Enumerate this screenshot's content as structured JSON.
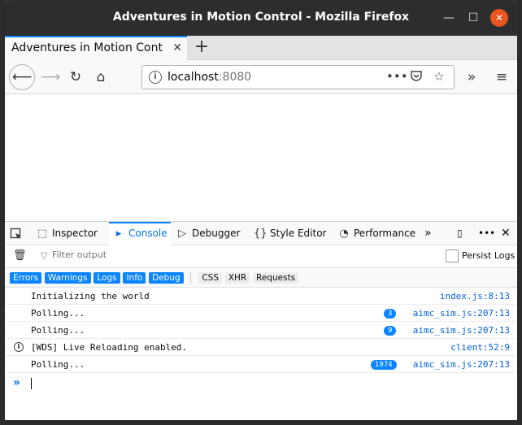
{
  "window": {
    "title": "Adventures in Motion Control - Mozilla Firefox"
  },
  "tabs": [
    {
      "label": "Adventures in Motion Control",
      "close": "✕"
    }
  ],
  "newtab": "+",
  "navbar": {
    "back": "⟵",
    "forward": "⟶",
    "reload": "↻",
    "home": "⌂",
    "url_host": "localhost",
    "url_port": ":8080",
    "more": "•••",
    "overflow": "»",
    "menu": "≡"
  },
  "devtools": {
    "tabs": [
      {
        "label": "Inspector",
        "icon": "inspector-icon"
      },
      {
        "label": "Console",
        "icon": "console-icon",
        "selected": true
      },
      {
        "label": "Debugger",
        "icon": "debugger-icon"
      },
      {
        "label": "Style Editor",
        "icon": "style-editor-icon"
      },
      {
        "label": "Performance",
        "icon": "performance-icon"
      }
    ],
    "more": "»",
    "filter_placeholder": "Filter output",
    "persist_logs": "Persist Logs",
    "categories": {
      "errors": "Errors",
      "warnings": "Warnings",
      "logs": "Logs",
      "info": "Info",
      "debug": "Debug",
      "css": "CSS",
      "xhr": "XHR",
      "requests": "Requests"
    },
    "messages": [
      {
        "text": "Initializing the world",
        "location": "index.js:8:13"
      },
      {
        "text": "Polling...",
        "count": "3",
        "location": "aimc_sim.js:207:13"
      },
      {
        "text": "Polling...",
        "count": "9",
        "location": "aimc_sim.js:207:13"
      },
      {
        "text": "[WDS] Live Reloading enabled.",
        "location": "client:52:9",
        "type": "info"
      },
      {
        "text": "Polling...",
        "count": "1974",
        "location": "aimc_sim.js:207:13"
      }
    ],
    "prompt": "»"
  },
  "colors": {
    "accent": "#0a84ff",
    "titlebar": "#2d2d2d",
    "close_button": "#e95420",
    "link": "#0060df"
  }
}
